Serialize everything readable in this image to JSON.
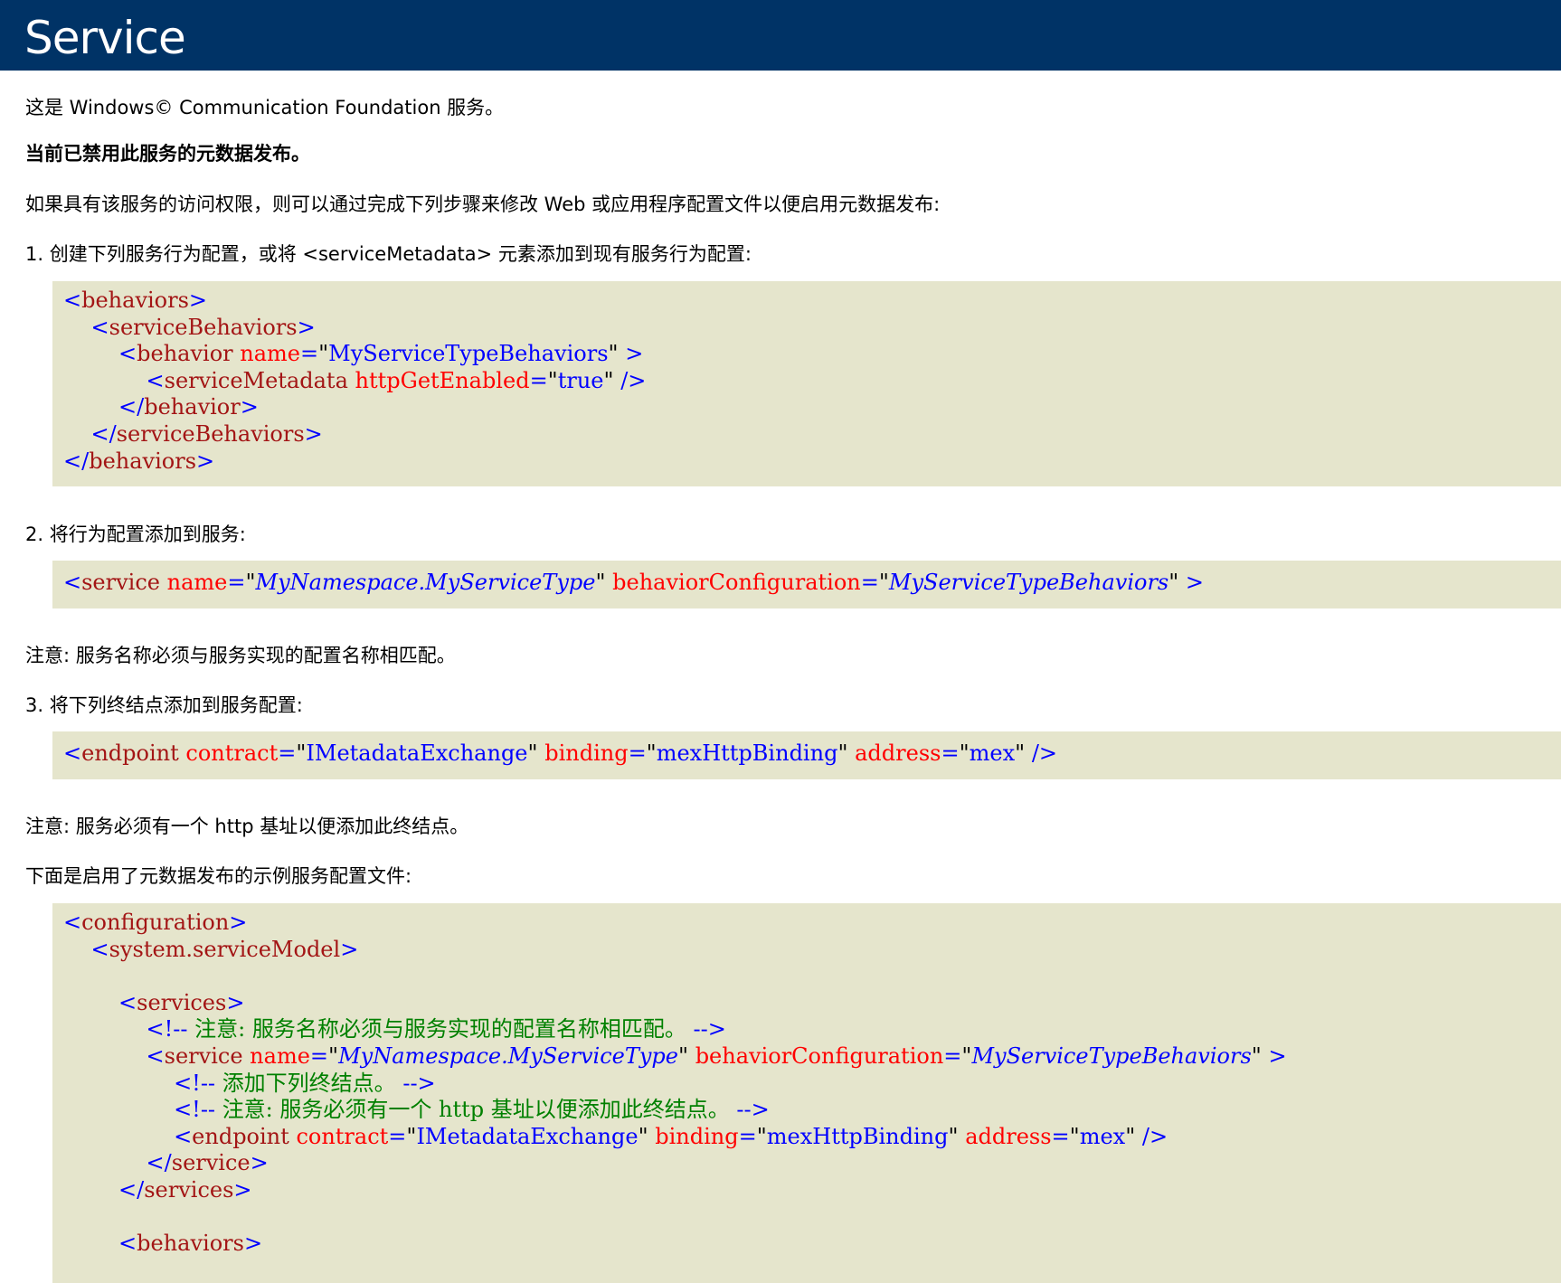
{
  "header": {
    "title": "Service"
  },
  "intro": "这是 Windows© Communication Foundation 服务。",
  "disabled_notice": "当前已禁用此服务的元数据发布。",
  "instructions": "如果具有该服务的访问权限，则可以通过完成下列步骤来修改 Web 或应用程序配置文件以便启用元数据发布:",
  "step1": "1. 创建下列服务行为配置，或将 <serviceMetadata> 元素添加到现有服务行为配置:",
  "code1": [
    "<behaviors>",
    "    <serviceBehaviors>",
    "        <behavior name=\"MyServiceTypeBehaviors\" >",
    "            <serviceMetadata httpGetEnabled=\"true\" />",
    "        </behavior>",
    "    </serviceBehaviors>",
    "</behaviors>"
  ],
  "step2": "2. 将行为配置添加到服务:",
  "code2": "<service name=\"MyNamespace.MyServiceType\" behaviorConfiguration=\"MyServiceTypeBehaviors\" >",
  "note1": "注意: 服务名称必须与服务实现的配置名称相匹配。",
  "step3": "3. 将下列终结点添加到服务配置:",
  "code3": "<endpoint contract=\"IMetadataExchange\" binding=\"mexHttpBinding\" address=\"mex\" />",
  "note2": "注意: 服务必须有一个 http 基址以便添加此终结点。",
  "sample_intro": "下面是启用了元数据发布的示例服务配置文件:",
  "code4": [
    "<configuration>",
    "    <system.serviceModel>",
    "",
    "        <services>",
    "            <!-- 注意: 服务名称必须与服务实现的配置名称相匹配。 -->",
    "            <service name=\"MyNamespace.MyServiceType\" behaviorConfiguration=\"MyServiceTypeBehaviors\" >",
    "                <!-- 添加下列终结点。 -->",
    "                <!-- 注意: 服务必须有一个 http 基址以便添加此终结点。 -->",
    "                <endpoint contract=\"IMetadataExchange\" binding=\"mexHttpBinding\" address=\"mex\" />",
    "            </service>",
    "        </services>",
    "",
    "        <behaviors>"
  ]
}
